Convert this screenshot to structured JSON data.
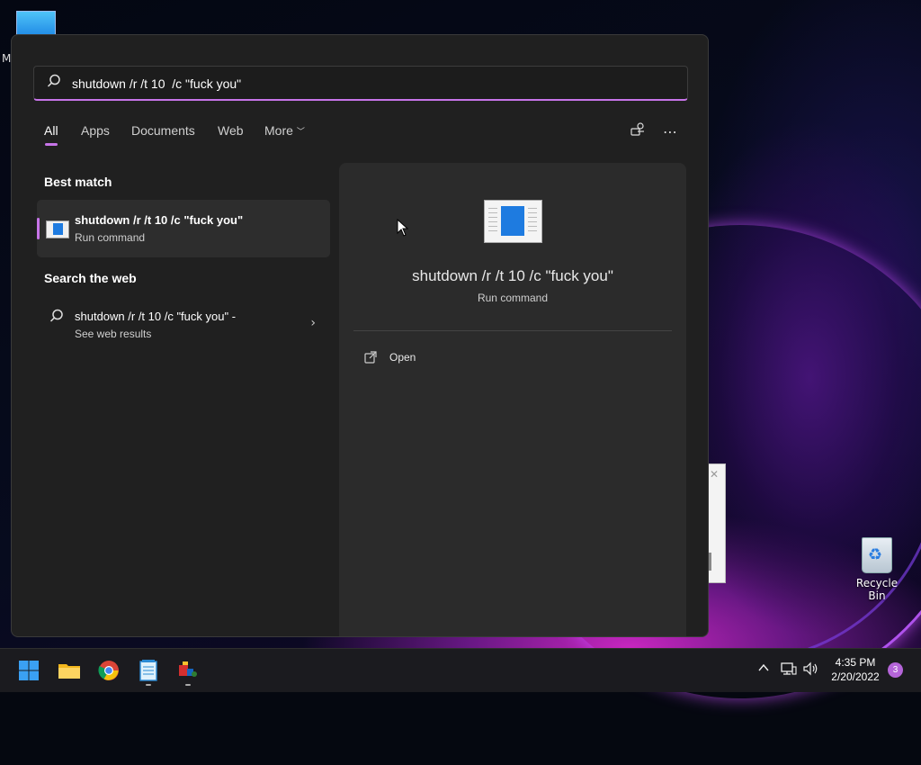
{
  "desktop": {
    "partial_label": "M",
    "recycle_bin_label": "Recycle Bin"
  },
  "search": {
    "query": "shutdown /r /t 10  /c \"fuck you\"",
    "tabs": [
      {
        "label": "All",
        "active": true
      },
      {
        "label": "Apps"
      },
      {
        "label": "Documents"
      },
      {
        "label": "Web"
      },
      {
        "label": "More"
      }
    ]
  },
  "results": {
    "best_match_title": "Best match",
    "best_match": {
      "title": "shutdown /r /t 10 /c \"fuck you\"",
      "subtitle": "Run command",
      "icon": "run-command-icon"
    },
    "web_title": "Search the web",
    "web_result": {
      "title": "shutdown /r /t 10 /c \"fuck you\" -",
      "subtitle": "See web results",
      "icon": "search-icon"
    }
  },
  "preview": {
    "title": "shutdown /r /t 10 /c \"fuck you\"",
    "subtitle": "Run command",
    "actions": [
      {
        "label": "Open",
        "icon": "open-external-icon"
      }
    ]
  },
  "taskbar": {
    "apps": [
      "start-icon",
      "file-explorer-icon",
      "chrome-icon",
      "notepad-icon",
      "app-icon"
    ],
    "tray": [
      "chevron-up-icon",
      "network-icon",
      "volume-icon"
    ],
    "time": "4:35 PM",
    "date": "2/20/2022",
    "notification_count": "3"
  },
  "colors": {
    "accent": "#c774e8",
    "panel_bg": "#202020",
    "preview_bg": "#2b2b2b",
    "taskbar_bg": "#1b1b1f"
  }
}
